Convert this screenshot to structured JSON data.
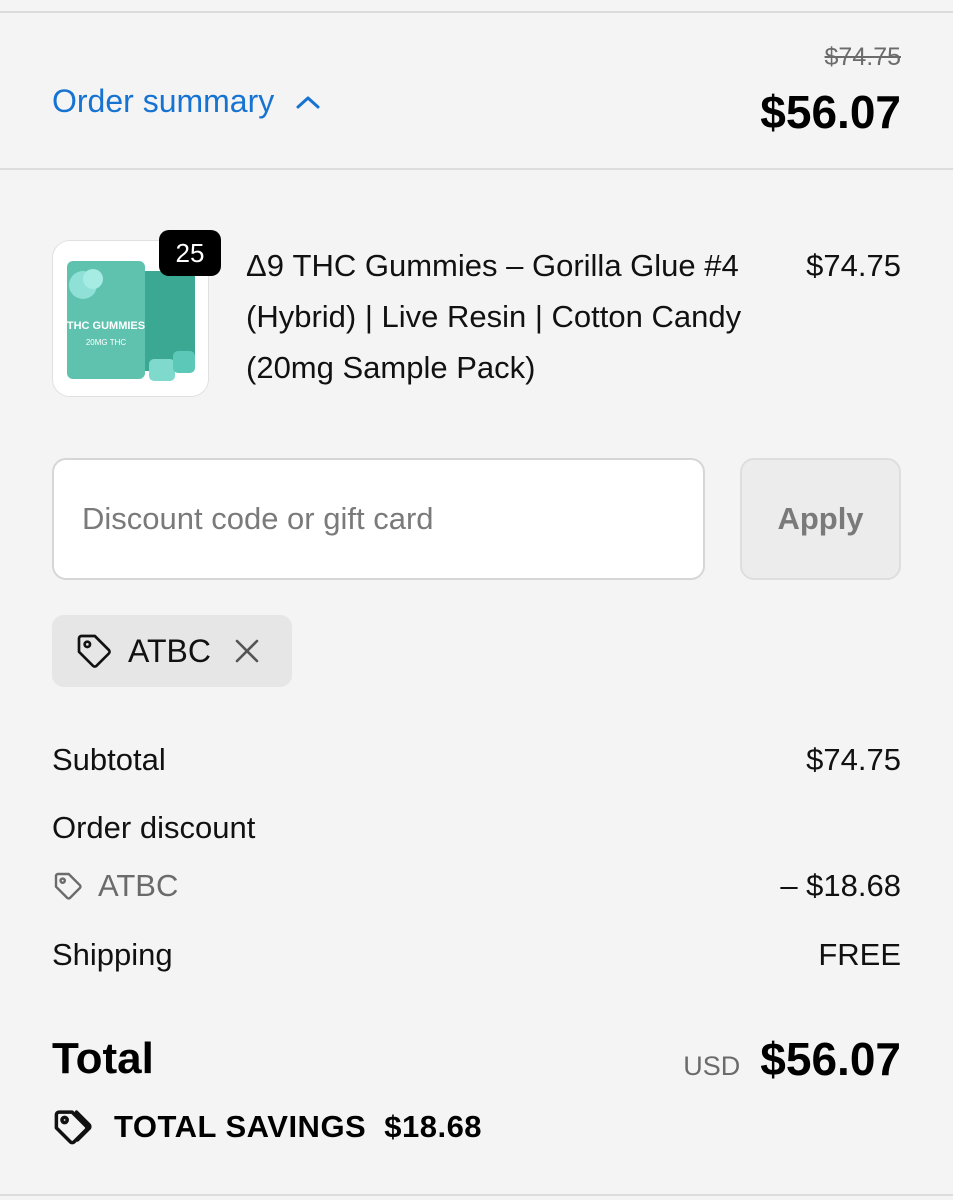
{
  "header": {
    "toggle_label": "Order summary",
    "compare_price": "$74.75",
    "total": "$56.07"
  },
  "product": {
    "title": "Δ9 THC Gummies – Gorilla Glue #4 (Hybrid) | Live Resin | Cotton Candy (20mg Sample Pack)",
    "price": "$74.75",
    "quantity": "25",
    "package_text": "THC GUMMIES",
    "package_sub": "20MG THC"
  },
  "discount": {
    "placeholder": "Discount code or gift card",
    "value": "",
    "apply_label": "Apply"
  },
  "applied_code": {
    "code": "ATBC"
  },
  "summary": {
    "subtotal_label": "Subtotal",
    "subtotal_value": "$74.75",
    "order_discount_label": "Order discount",
    "discount_code": "ATBC",
    "discount_value": "– $18.68",
    "shipping_label": "Shipping",
    "shipping_value": "FREE"
  },
  "total": {
    "label": "Total",
    "currency": "USD",
    "amount": "$56.07"
  },
  "savings": {
    "label": "TOTAL SAVINGS",
    "amount": "$18.68"
  },
  "colors": {
    "accent": "#1773d2",
    "background": "#f4f4f4",
    "muted": "#6b6b6b"
  }
}
